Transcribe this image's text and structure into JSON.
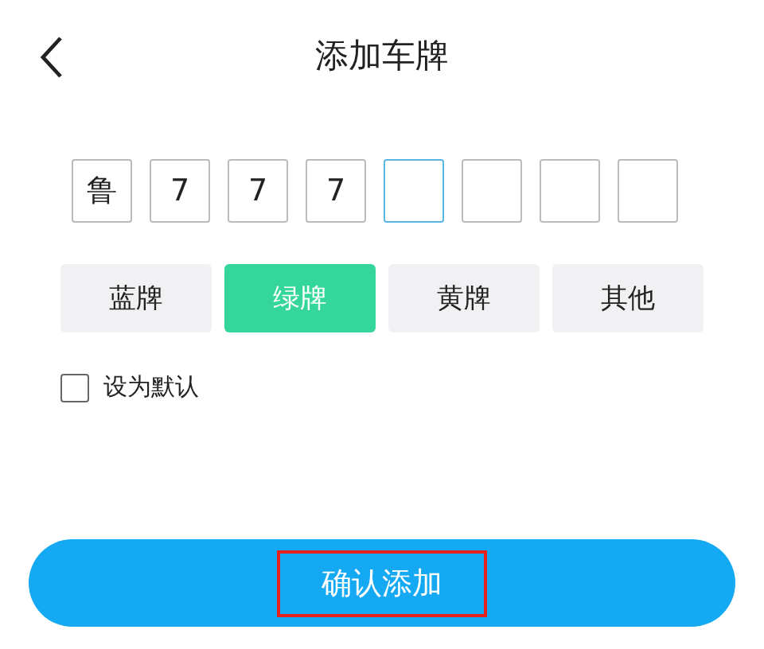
{
  "header": {
    "title": "添加车牌"
  },
  "plate_chars": [
    {
      "char": "鲁",
      "selected": false
    },
    {
      "char": "7",
      "selected": false
    },
    {
      "char": "7",
      "selected": false
    },
    {
      "char": "7",
      "selected": false
    },
    {
      "selected": true
    },
    {
      "selected": false
    },
    {
      "selected": false
    },
    {
      "selected": false
    }
  ],
  "plate_types": [
    {
      "label": "蓝牌",
      "selected": false
    },
    {
      "label": "绿牌",
      "selected": true
    },
    {
      "label": "黄牌",
      "selected": false
    },
    {
      "label": "其他",
      "selected": false
    }
  ],
  "default_option": {
    "label": "设为默认",
    "checked": false
  },
  "confirm_button": {
    "label": "确认添加",
    "highlighted": true
  }
}
